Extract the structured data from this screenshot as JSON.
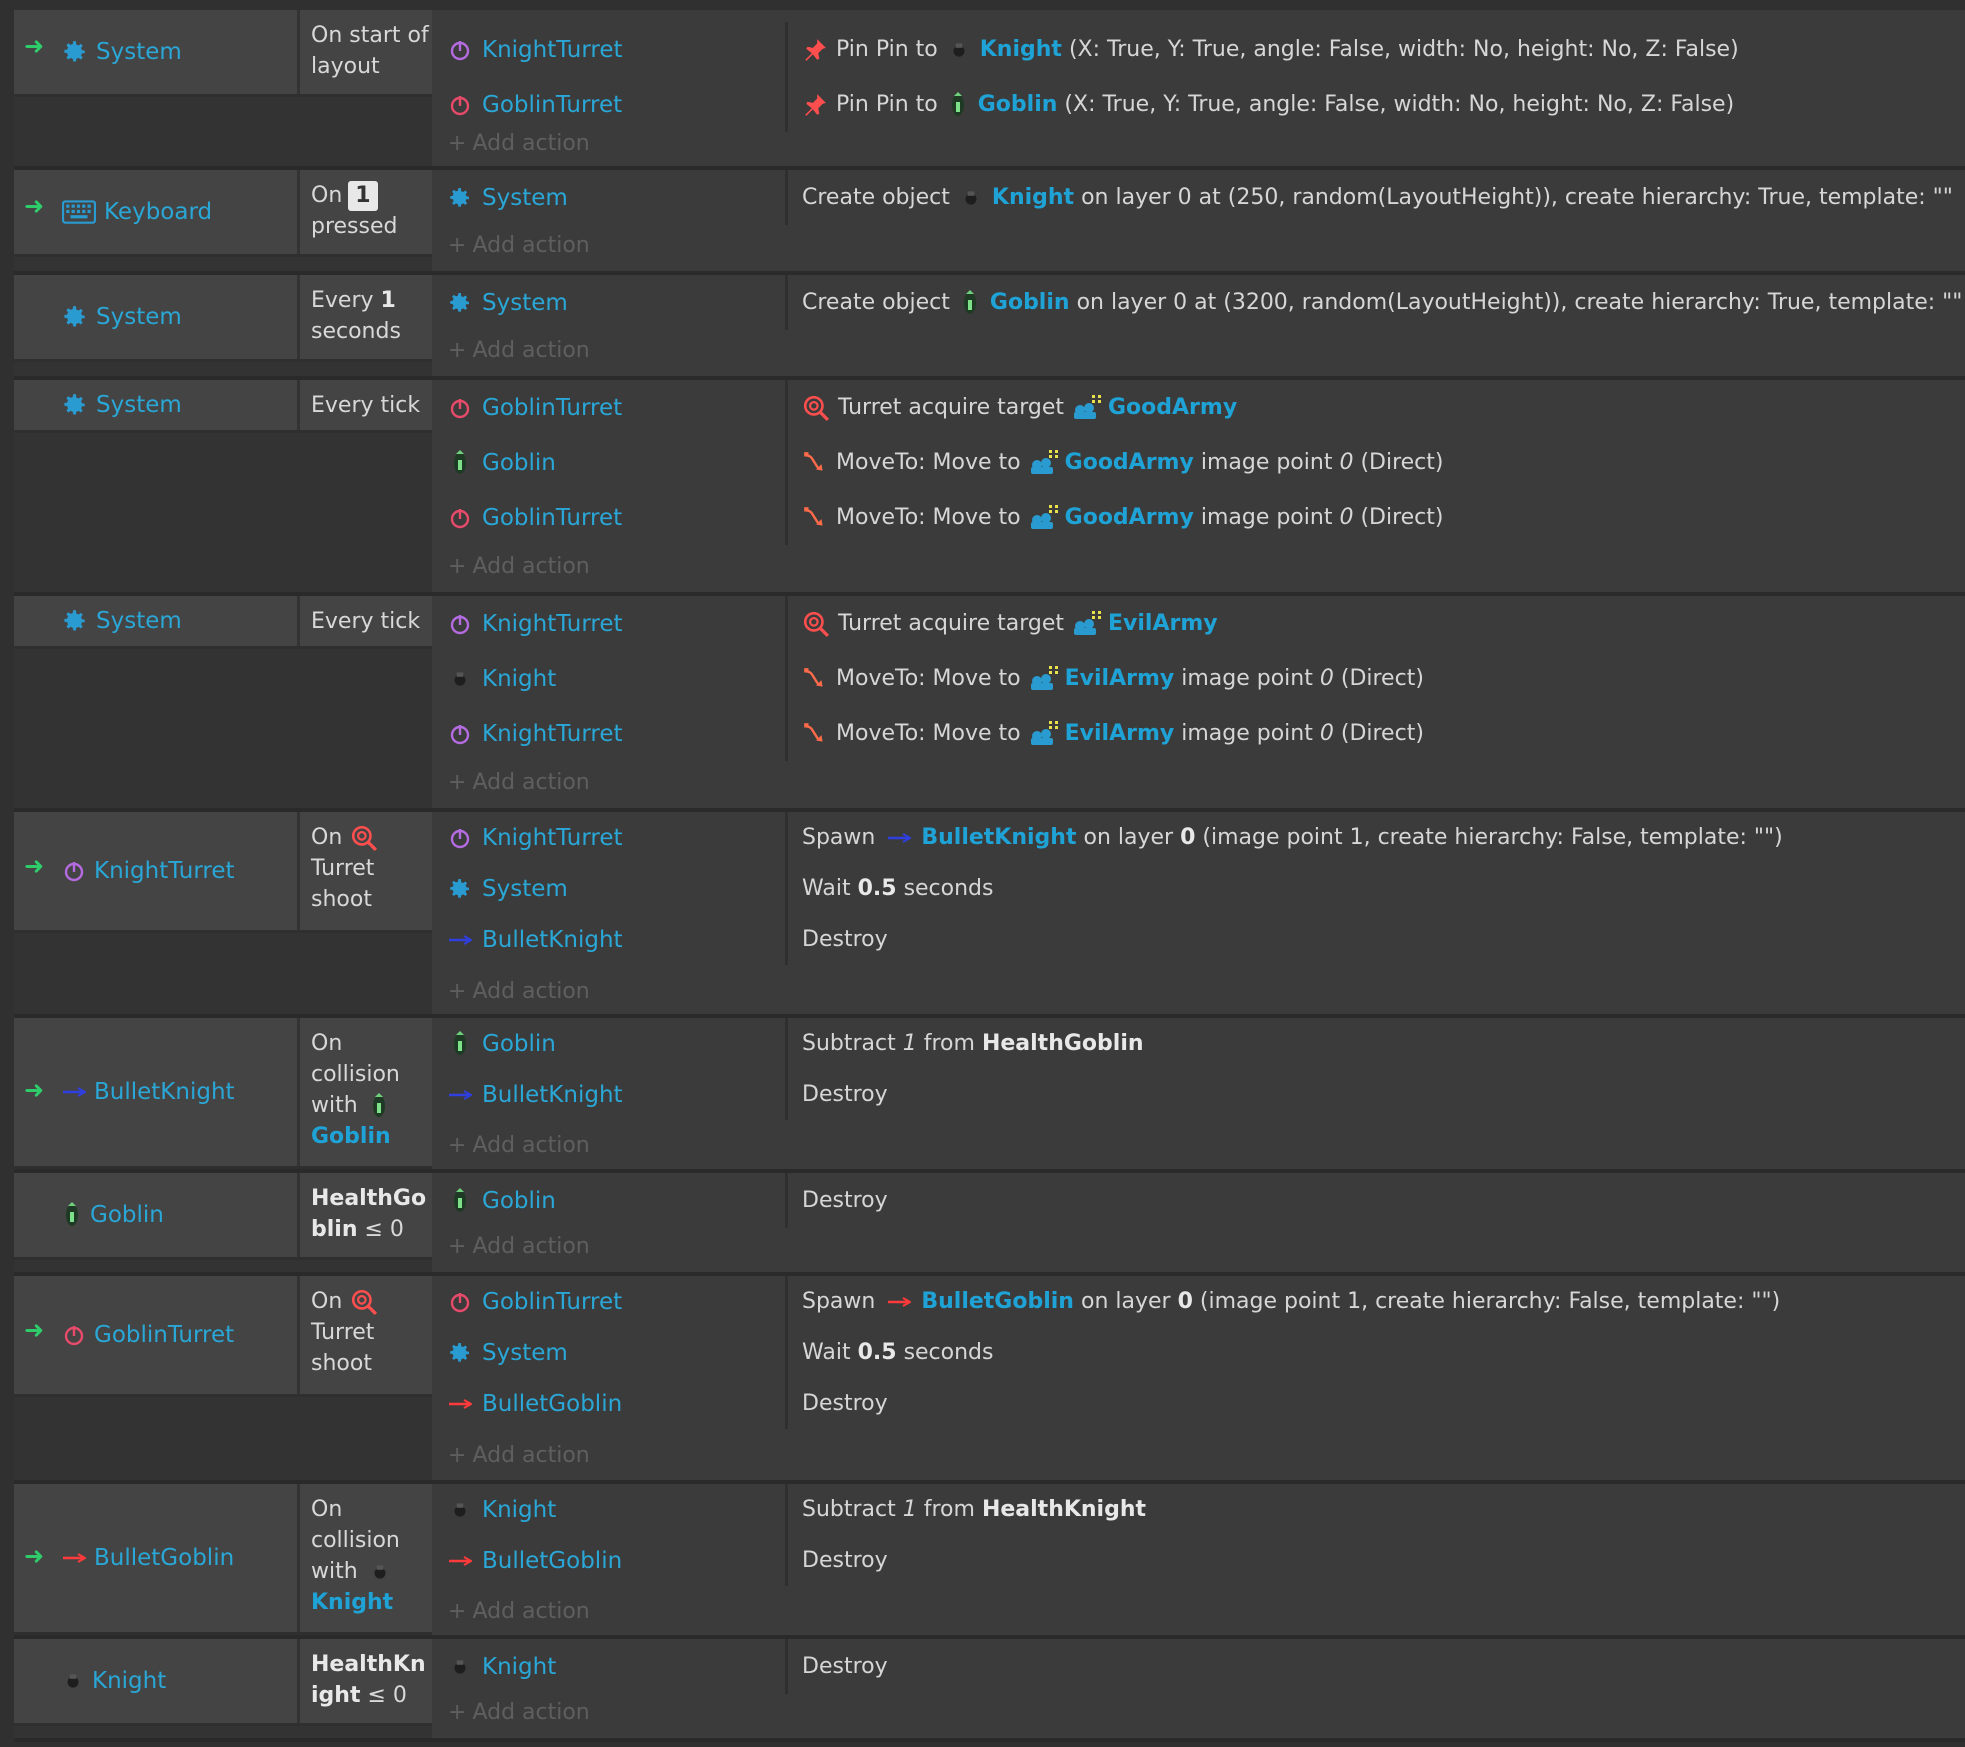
{
  "common": {
    "add_action": "Add action",
    "trigger_arrow": "➜"
  },
  "events": [
    {
      "cond_object": "System",
      "cond_text": "On start of layout",
      "actions": [
        {
          "object": "KnightTurret",
          "desc_prefix": "Pin Pin to",
          "target": "Knight",
          "desc_suffix": "(X: True, Y: True, angle: False, width: No, height: No, Z: False)"
        },
        {
          "object": "GoblinTurret",
          "desc_prefix": "Pin Pin to",
          "target": "Goblin",
          "desc_suffix": "(X: True, Y: True, angle: False, width: No, height: No, Z: False)"
        }
      ]
    },
    {
      "cond_object": "Keyboard",
      "cond_text_prefix": "On",
      "cond_key": "1",
      "cond_text_suffix": "pressed",
      "actions": [
        {
          "object": "System",
          "desc_prefix": "Create object",
          "target": "Knight",
          "desc_suffix": "on layer 0 at (250, random(LayoutHeight)), create hierarchy: True, template: \"\""
        }
      ]
    },
    {
      "cond_object": "System",
      "cond_text_prefix": "Every",
      "cond_value": "1",
      "cond_text_suffix": "seconds",
      "actions": [
        {
          "object": "System",
          "desc_prefix": "Create object",
          "target": "Goblin",
          "desc_suffix": "on layer 0 at (3200, random(LayoutHeight)), create hierarchy: True, template: \"\""
        }
      ]
    },
    {
      "cond_object": "System",
      "cond_text": "Every tick",
      "actions": [
        {
          "object": "GoblinTurret",
          "desc_prefix": "Turret acquire target",
          "target": "GoodArmy",
          "desc_suffix": ""
        },
        {
          "object": "Goblin",
          "desc_prefix": "MoveTo: Move to",
          "target": "GoodArmy",
          "desc_suffix_a": "image point",
          "desc_num": "0",
          "desc_suffix_b": "(Direct)"
        },
        {
          "object": "GoblinTurret",
          "desc_prefix": "MoveTo: Move to",
          "target": "GoodArmy",
          "desc_suffix_a": "image point",
          "desc_num": "0",
          "desc_suffix_b": "(Direct)"
        }
      ]
    },
    {
      "cond_object": "System",
      "cond_text": "Every tick",
      "actions": [
        {
          "object": "KnightTurret",
          "desc_prefix": "Turret acquire target",
          "target": "EvilArmy",
          "desc_suffix": ""
        },
        {
          "object": "Knight",
          "desc_prefix": "MoveTo: Move to",
          "target": "EvilArmy",
          "desc_suffix_a": "image point",
          "desc_num": "0",
          "desc_suffix_b": "(Direct)"
        },
        {
          "object": "KnightTurret",
          "desc_prefix": "MoveTo: Move to",
          "target": "EvilArmy",
          "desc_suffix_a": "image point",
          "desc_num": "0",
          "desc_suffix_b": "(Direct)"
        }
      ]
    },
    {
      "cond_object": "KnightTurret",
      "cond_text_prefix": "On",
      "cond_text_suffix": "Turret shoot",
      "actions": [
        {
          "object": "KnightTurret",
          "desc_prefix": "Spawn",
          "target": "BulletKnight",
          "desc_suffix_a": "on layer",
          "desc_layer": "0",
          "desc_suffix_b": "(image point 1, create hierarchy: False, template: \"\")"
        },
        {
          "object": "System",
          "desc_prefix": "Wait",
          "desc_value": "0.5",
          "desc_suffix": "seconds"
        },
        {
          "object": "BulletKnight",
          "desc_prefix": "Destroy"
        }
      ]
    },
    {
      "cond_object": "BulletKnight",
      "cond_text_prefix": "On collision with",
      "cond_target": "Goblin",
      "actions": [
        {
          "object": "Goblin",
          "desc_prefix": "Subtract",
          "desc_num": "1",
          "desc_mid": "from",
          "desc_var": "HealthGoblin"
        },
        {
          "object": "BulletKnight",
          "desc_prefix": "Destroy"
        }
      ]
    },
    {
      "cond_object": "Goblin",
      "cond_var": "HealthGoblin",
      "cond_cmp": "≤ 0",
      "actions": [
        {
          "object": "Goblin",
          "desc_prefix": "Destroy"
        }
      ]
    },
    {
      "cond_object": "GoblinTurret",
      "cond_text_prefix": "On",
      "cond_text_suffix": "Turret shoot",
      "actions": [
        {
          "object": "GoblinTurret",
          "desc_prefix": "Spawn",
          "target": "BulletGoblin",
          "desc_suffix_a": "on layer",
          "desc_layer": "0",
          "desc_suffix_b": "(image point 1, create hierarchy: False, template: \"\")"
        },
        {
          "object": "System",
          "desc_prefix": "Wait",
          "desc_value": "0.5",
          "desc_suffix": "seconds"
        },
        {
          "object": "BulletGoblin",
          "desc_prefix": "Destroy"
        }
      ]
    },
    {
      "cond_object": "BulletGoblin",
      "cond_text_prefix": "On collision with",
      "cond_target": "Knight",
      "actions": [
        {
          "object": "Knight",
          "desc_prefix": "Subtract",
          "desc_num": "1",
          "desc_mid": "from",
          "desc_var": "HealthKnight"
        },
        {
          "object": "BulletGoblin",
          "desc_prefix": "Destroy"
        }
      ]
    },
    {
      "cond_object": "Knight",
      "cond_var": "HealthKnight",
      "cond_cmp": "≤ 0",
      "actions": [
        {
          "object": "Knight",
          "desc_prefix": "Destroy"
        }
      ]
    }
  ]
}
